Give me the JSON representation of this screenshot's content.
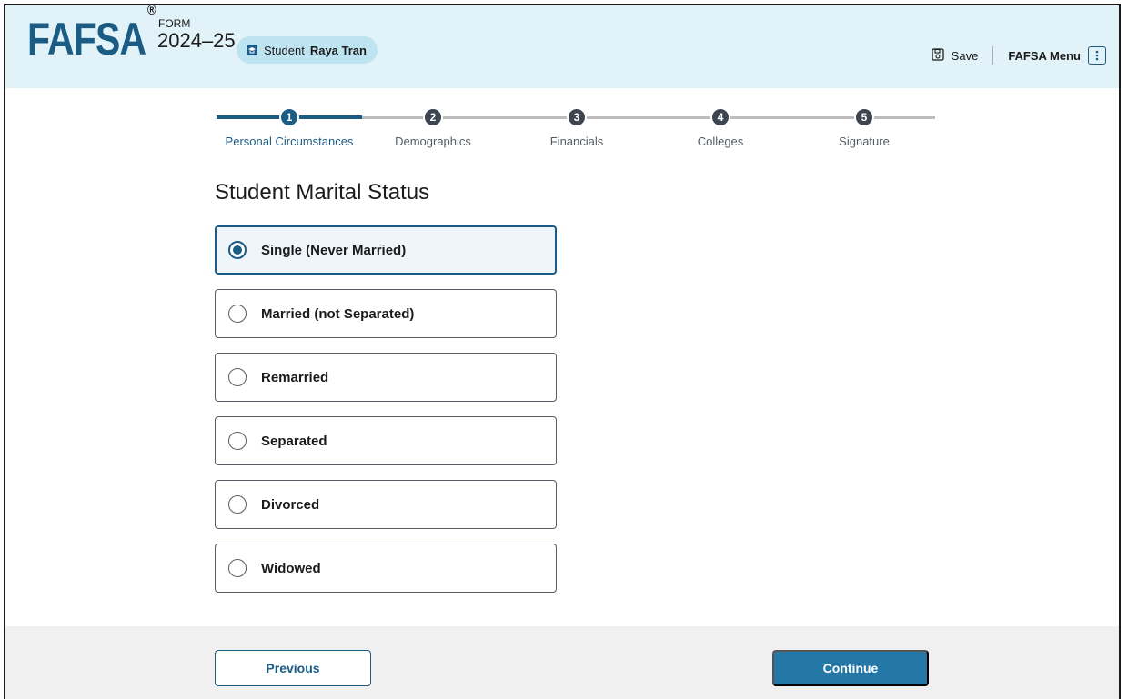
{
  "header": {
    "logo_text": "FAFSA",
    "logo_mark": "®",
    "form_label": "FORM",
    "form_year": "2024–25",
    "student_prefix": "Student",
    "student_name": "Raya Tran",
    "save_label": "Save",
    "menu_label": "FAFSA Menu"
  },
  "stepper": {
    "steps": [
      {
        "number": "1",
        "label": "Personal Circumstances",
        "state": "active"
      },
      {
        "number": "2",
        "label": "Demographics",
        "state": "upcoming"
      },
      {
        "number": "3",
        "label": "Financials",
        "state": "upcoming"
      },
      {
        "number": "4",
        "label": "Colleges",
        "state": "upcoming"
      },
      {
        "number": "5",
        "label": "Signature",
        "state": "upcoming"
      }
    ]
  },
  "main": {
    "title": "Student Marital Status",
    "options": [
      {
        "label": "Single (Never Married)",
        "selected": true
      },
      {
        "label": "Married (not Separated)",
        "selected": false
      },
      {
        "label": "Remarried",
        "selected": false
      },
      {
        "label": "Separated",
        "selected": false
      },
      {
        "label": "Divorced",
        "selected": false
      },
      {
        "label": "Widowed",
        "selected": false
      }
    ]
  },
  "footer": {
    "previous_label": "Previous",
    "continue_label": "Continue"
  },
  "colors": {
    "primary": "#1b5c84",
    "primary_button": "#2378a8",
    "header_bg": "#e1f3f8",
    "footer_bg": "#f0f0f0"
  },
  "icons": {
    "student": "graduation-cap-icon",
    "save": "floppy-disk-icon",
    "menu": "vertical-dots-icon"
  }
}
